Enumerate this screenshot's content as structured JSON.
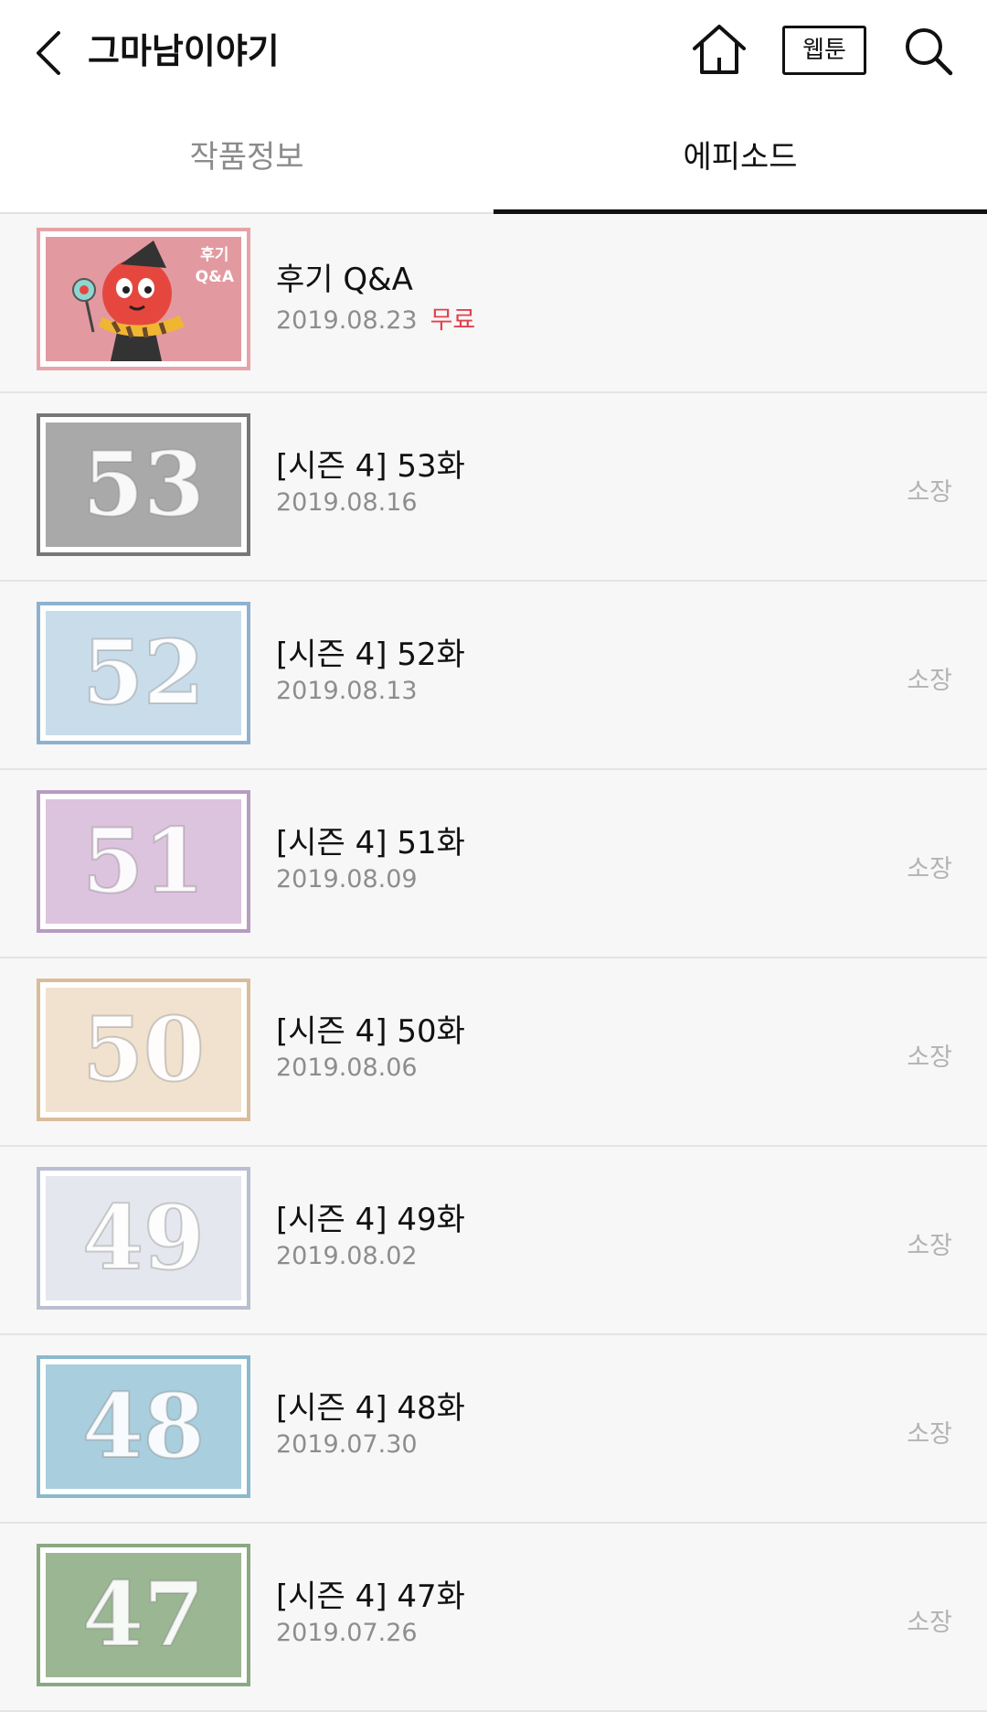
{
  "header": {
    "title": "그마남이야기",
    "webtoon_button": "웹툰"
  },
  "tabs": [
    {
      "label": "작품정보",
      "active": false
    },
    {
      "label": "에피소드",
      "active": true
    }
  ],
  "episodes": [
    {
      "title": "후기 Q&A",
      "date": "2019.08.23",
      "badge": "무료",
      "status": "",
      "thumb_text": "",
      "thumb_caption": "후기\nQ&A",
      "thumb_color": "#e29aa0",
      "thumb_border": "#e7a3a8"
    },
    {
      "title": "[시즌 4] 53화",
      "date": "2019.08.16",
      "status": "소장",
      "thumb_text": "53",
      "thumb_color": "#a9a9a9",
      "thumb_border": "#777777"
    },
    {
      "title": "[시즌 4] 52화",
      "date": "2019.08.13",
      "status": "소장",
      "thumb_text": "52",
      "thumb_color": "#c9dcea",
      "thumb_border": "#8fb1cf"
    },
    {
      "title": "[시즌 4] 51화",
      "date": "2019.08.09",
      "status": "소장",
      "thumb_text": "51",
      "thumb_color": "#dcc3de",
      "thumb_border": "#b79cc0"
    },
    {
      "title": "[시즌 4] 50화",
      "date": "2019.08.06",
      "status": "소장",
      "thumb_text": "50",
      "thumb_color": "#f1e1cf",
      "thumb_border": "#d9bd9a"
    },
    {
      "title": "[시즌 4] 49화",
      "date": "2019.08.02",
      "status": "소장",
      "thumb_text": "49",
      "thumb_color": "#e5e7ef",
      "thumb_border": "#b9bfd0"
    },
    {
      "title": "[시즌 4] 48화",
      "date": "2019.07.30",
      "status": "소장",
      "thumb_text": "48",
      "thumb_color": "#a9cedd",
      "thumb_border": "#8bb9cc"
    },
    {
      "title": "[시즌 4] 47화",
      "date": "2019.07.26",
      "status": "소장",
      "thumb_text": "47",
      "thumb_color": "#9ab692",
      "thumb_border": "#8aa982"
    }
  ]
}
